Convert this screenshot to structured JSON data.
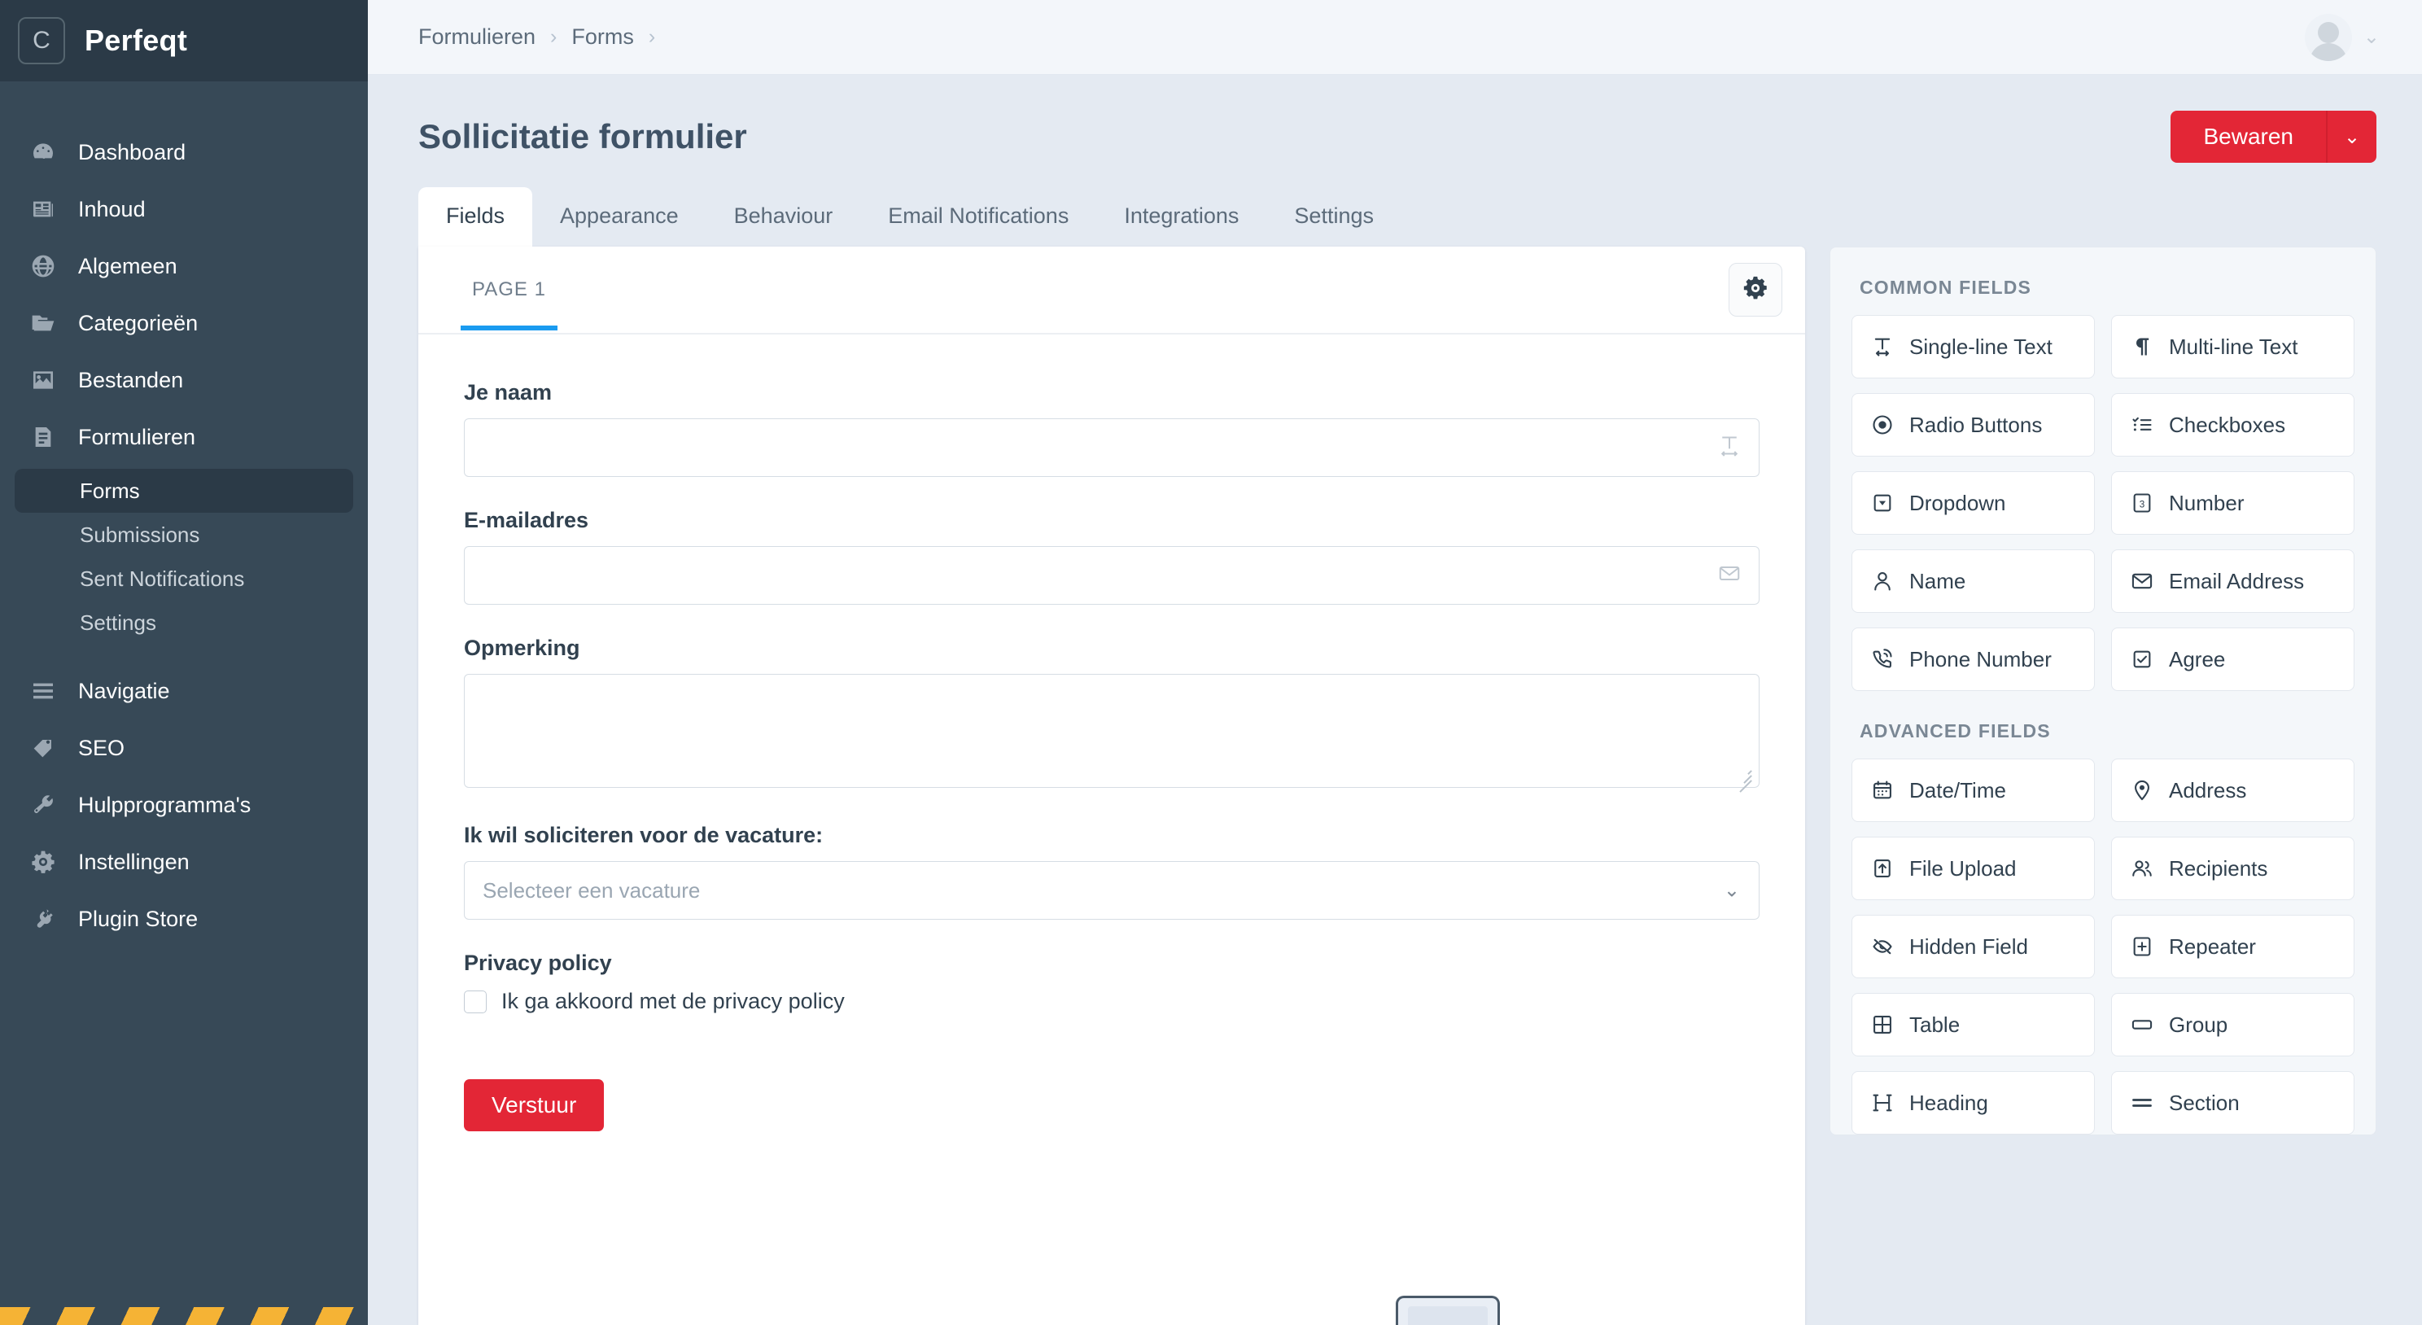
{
  "brand": {
    "mark": "C",
    "name": "Perfeqt"
  },
  "sidebar": {
    "items": [
      {
        "label": "Dashboard",
        "icon": "dashboard-icon"
      },
      {
        "label": "Inhoud",
        "icon": "content-icon"
      },
      {
        "label": "Algemeen",
        "icon": "globe-icon"
      },
      {
        "label": "Categorieën",
        "icon": "folder-icon"
      },
      {
        "label": "Bestanden",
        "icon": "image-icon"
      },
      {
        "label": "Formulieren",
        "icon": "form-icon"
      }
    ],
    "sub_items": [
      {
        "label": "Forms",
        "active": true
      },
      {
        "label": "Submissions",
        "active": false
      },
      {
        "label": "Sent Notifications",
        "active": false
      },
      {
        "label": "Settings",
        "active": false
      }
    ],
    "items_lower": [
      {
        "label": "Navigatie",
        "icon": "menu-icon"
      },
      {
        "label": "SEO",
        "icon": "seo-tag-icon"
      },
      {
        "label": "Hulpprogramma's",
        "icon": "wrench-icon"
      },
      {
        "label": "Instellingen",
        "icon": "gear-icon"
      },
      {
        "label": "Plugin Store",
        "icon": "plug-icon"
      }
    ]
  },
  "topbar": {
    "breadcrumbs": [
      "Formulieren",
      "Forms"
    ],
    "separator": "›"
  },
  "page": {
    "title": "Sollicitatie formulier",
    "save_label": "Bewaren",
    "save_caret": "⌄"
  },
  "tabs": [
    {
      "label": "Fields",
      "active": true
    },
    {
      "label": "Appearance",
      "active": false
    },
    {
      "label": "Behaviour",
      "active": false
    },
    {
      "label": "Email Notifications",
      "active": false
    },
    {
      "label": "Integrations",
      "active": false
    },
    {
      "label": "Settings",
      "active": false
    }
  ],
  "canvas": {
    "page_tab": "PAGE 1",
    "settings_icon": "gear-icon",
    "fields": [
      {
        "label": "Je naam",
        "type": "text",
        "value": "",
        "placeholder": "",
        "icon": "single-line-text-icon"
      },
      {
        "label": "E-mailadres",
        "type": "text",
        "value": "",
        "placeholder": "",
        "icon": "envelope-icon"
      },
      {
        "label": "Opmerking",
        "type": "textarea",
        "value": "",
        "placeholder": ""
      },
      {
        "label": "Ik wil soliciteren voor de vacature:",
        "type": "select",
        "value": "",
        "placeholder": "Selecteer een vacature"
      },
      {
        "label": "Privacy policy",
        "type": "checkbox",
        "checkbox_label": "Ik ga akkoord met de privacy policy",
        "checked": false
      }
    ],
    "submit_label": "Verstuur"
  },
  "palette": {
    "common_title": "COMMON FIELDS",
    "common_items": [
      {
        "label": "Single-line Text",
        "icon": "single-line-text-icon"
      },
      {
        "label": "Multi-line Text",
        "icon": "paragraph-icon"
      },
      {
        "label": "Radio Buttons",
        "icon": "radio-icon"
      },
      {
        "label": "Checkboxes",
        "icon": "checklist-icon"
      },
      {
        "label": "Dropdown",
        "icon": "dropdown-icon"
      },
      {
        "label": "Number",
        "icon": "number-icon"
      },
      {
        "label": "Name",
        "icon": "person-icon"
      },
      {
        "label": "Email Address",
        "icon": "envelope-icon"
      },
      {
        "label": "Phone Number",
        "icon": "phone-icon"
      },
      {
        "label": "Agree",
        "icon": "checkbox-checked-icon"
      }
    ],
    "advanced_title": "ADVANCED FIELDS",
    "advanced_items": [
      {
        "label": "Date/Time",
        "icon": "calendar-icon"
      },
      {
        "label": "Address",
        "icon": "map-pin-icon"
      },
      {
        "label": "File Upload",
        "icon": "upload-icon"
      },
      {
        "label": "Recipients",
        "icon": "people-icon"
      },
      {
        "label": "Hidden Field",
        "icon": "eye-off-icon"
      },
      {
        "label": "Repeater",
        "icon": "plus-box-icon"
      },
      {
        "label": "Table",
        "icon": "table-icon"
      },
      {
        "label": "Group",
        "icon": "group-box-icon"
      },
      {
        "label": "Heading",
        "icon": "heading-icon"
      },
      {
        "label": "Section",
        "icon": "section-icon"
      }
    ]
  },
  "colors": {
    "accent_red": "#e32636",
    "sidebar": "#374957",
    "tab_underline": "#1a9bf0"
  }
}
